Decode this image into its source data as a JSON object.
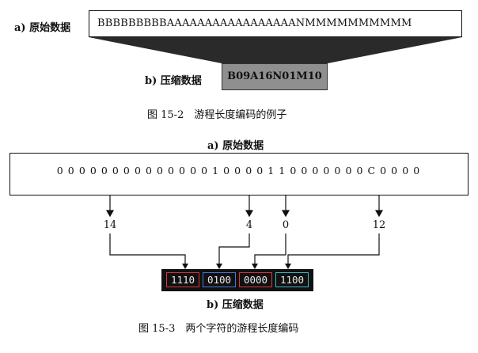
{
  "fig1": {
    "original_label": "a) 原始数据",
    "original_data": "BBBBBBBBBAAAAAAAAAAAAAAAAANMMMMMMMMMM",
    "compressed_label": "b) 压缩数据",
    "compressed_data": "B09A16N01M10",
    "caption": "图 15-2　游程长度编码的例子"
  },
  "fig2": {
    "original_label": "a) 原始数据",
    "bits": "0 0 0 0 0 0 0 0 0 0 0 0 0 0 1 0 0 0 0 1 1 0 0 0 0 0 0 0 C 0 0 0 0",
    "run_lengths": [
      "14",
      "4",
      "0",
      "12"
    ],
    "codes": [
      "1110",
      "0100",
      "0000",
      "1100"
    ],
    "code_colors": [
      "#d9363e",
      "#4a78d6",
      "#d9363e",
      "#3fb8c8"
    ],
    "compressed_label": "b) 压缩数据",
    "caption": "图 15-3　两个字符的游程长度编码"
  }
}
